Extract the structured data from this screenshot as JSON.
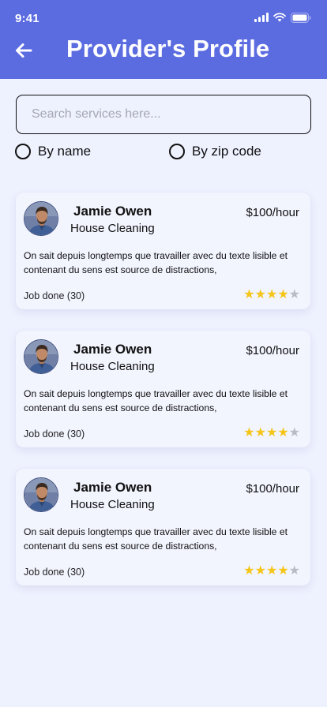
{
  "status_bar": {
    "time": "9:41"
  },
  "header": {
    "title": "Provider's Profile",
    "color": "#5B6BE0"
  },
  "search": {
    "placeholder": "Search services here..."
  },
  "filters": {
    "by_name": "By name",
    "by_zip": "By zip code"
  },
  "providers": [
    {
      "name": "Jamie Owen",
      "service": "House Cleaning",
      "price": "$100/hour",
      "description": "On sait depuis longtemps que travailler avec du texte lisible et contenant du sens est source de distractions,",
      "jobs": "Job done (30)",
      "rating": 4,
      "rating_max": 5
    },
    {
      "name": "Jamie Owen",
      "service": "House Cleaning",
      "price": "$100/hour",
      "description": "On sait depuis longtemps que travailler avec du texte lisible et contenant du sens est source de distractions,",
      "jobs": "Job done (30)",
      "rating": 4,
      "rating_max": 5
    },
    {
      "name": "Jamie Owen",
      "service": "House Cleaning",
      "price": "$100/hour",
      "description": "On sait depuis longtemps que travailler avec du texte lisible et contenant du sens est source de distractions,",
      "jobs": "Job done (30)",
      "rating": 4,
      "rating_max": 5
    }
  ]
}
